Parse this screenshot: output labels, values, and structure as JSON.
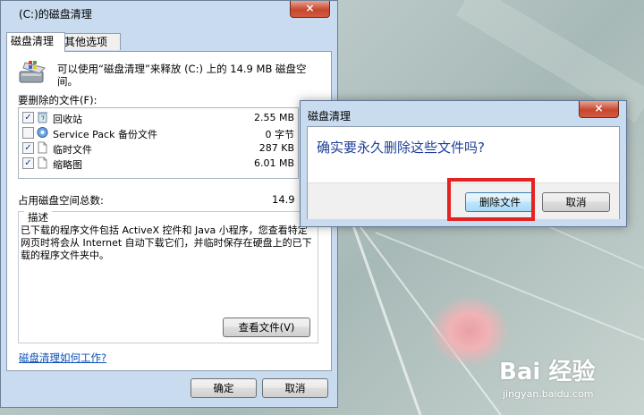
{
  "main_window": {
    "title": "(C:)的磁盘清理",
    "close_symbol": "×",
    "tabs": [
      "磁盘清理",
      "其他选项"
    ],
    "intro": "可以使用“磁盘清理”来释放 (C:) 上的 14.9 MB 磁盘空间。",
    "files_label": "要删除的文件(F):",
    "files": [
      {
        "name": "回收站",
        "size": "2.55 MB",
        "checked": true,
        "icon": "recycle-bin-icon"
      },
      {
        "name": "Service Pack 备份文件",
        "size": "0 字节",
        "checked": false,
        "icon": "service-pack-icon"
      },
      {
        "name": "临时文件",
        "size": "287 KB",
        "checked": true,
        "icon": "document-icon"
      },
      {
        "name": "缩略图",
        "size": "6.01 MB",
        "checked": true,
        "icon": "document-icon"
      }
    ],
    "check_mark": "✓",
    "space_label": "占用磁盘空间总数:",
    "space_value": "14.9",
    "description_title": "描述",
    "description": "已下载的程序文件包括 ActiveX 控件和 Java 小程序，您查看特定网页时将会从 Internet 自动下载它们，并临时保存在硬盘上的已下载的程序文件夹中。",
    "view_files_button": "查看文件(V)",
    "help_link": "磁盘清理如何工作?",
    "ok_button": "确定",
    "cancel_button": "取消"
  },
  "dialog": {
    "title": "磁盘清理",
    "close_symbol": "×",
    "message": "确实要永久删除这些文件吗?",
    "delete_button": "删除文件",
    "cancel_button": "取消"
  },
  "watermark": {
    "logo": "Bai 经验",
    "url": "jingyan.baidu.com"
  },
  "colors": {
    "highlight": "#e32222",
    "dialog_message": "#1f3f9a",
    "link": "#0b4fb5"
  }
}
